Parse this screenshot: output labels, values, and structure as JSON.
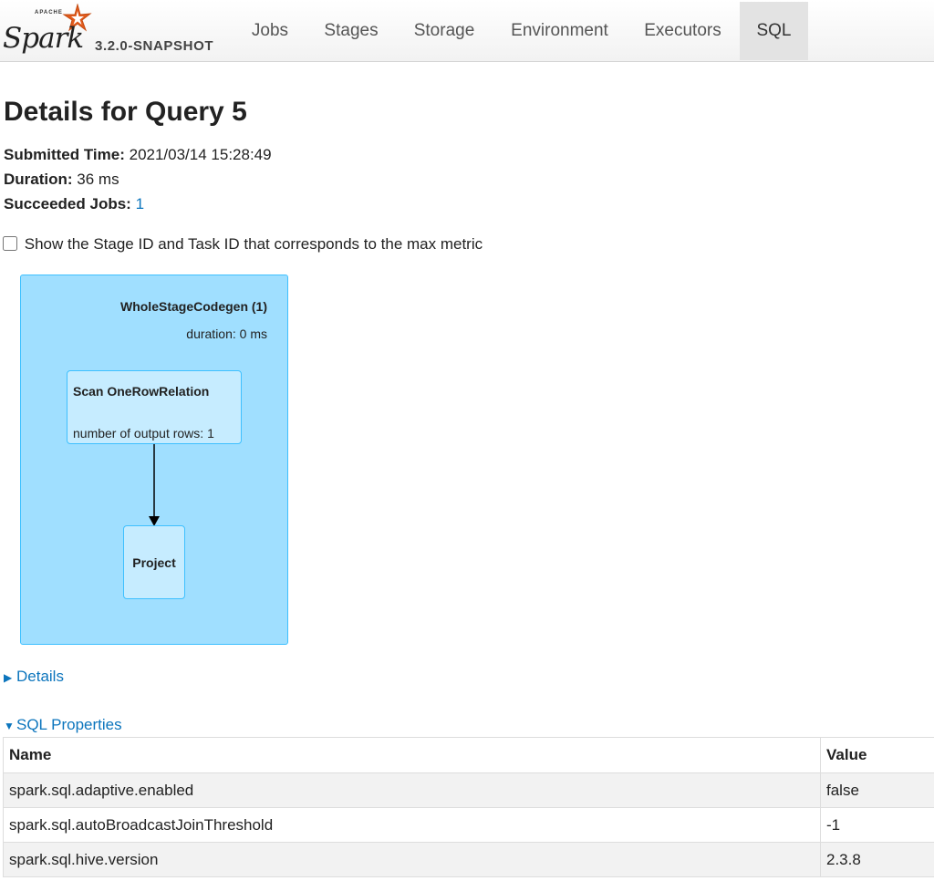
{
  "brand": {
    "apache": "APACHE",
    "word": "Spark",
    "version": "3.2.0-SNAPSHOT",
    "logo_color": "#e25a1c"
  },
  "nav": {
    "tabs": [
      {
        "label": "Jobs",
        "active": false
      },
      {
        "label": "Stages",
        "active": false
      },
      {
        "label": "Storage",
        "active": false
      },
      {
        "label": "Environment",
        "active": false
      },
      {
        "label": "Executors",
        "active": false
      },
      {
        "label": "SQL",
        "active": true
      }
    ]
  },
  "page": {
    "title": "Details for Query 5",
    "submitted_label": "Submitted Time:",
    "submitted_value": "2021/03/14 15:28:49",
    "duration_label": "Duration:",
    "duration_value": "36 ms",
    "jobs_label": "Succeeded Jobs:",
    "jobs_value": "1",
    "checkbox_label": "Show the Stage ID and Task ID that corresponds to the max metric",
    "checkbox_checked": false
  },
  "dag": {
    "cluster_title": "WholeStageCodegen (1)",
    "cluster_metric": "duration: 0 ms",
    "scan_name": "Scan OneRowRelation",
    "scan_metric": "number of output rows: 1",
    "project_name": "Project",
    "colors": {
      "cluster": "#a0dfff",
      "node": "#c6ecff",
      "border": "#3ec0ff"
    }
  },
  "details": {
    "label": "Details",
    "expanded": false
  },
  "sql_properties": {
    "label": "SQL Properties",
    "expanded": true,
    "columns": [
      "Name",
      "Value"
    ],
    "rows": [
      {
        "name": "spark.sql.adaptive.enabled",
        "value": "false"
      },
      {
        "name": "spark.sql.autoBroadcastJoinThreshold",
        "value": "-1"
      },
      {
        "name": "spark.sql.hive.version",
        "value": "2.3.8"
      }
    ]
  },
  "accent_color": "#0c75bd"
}
